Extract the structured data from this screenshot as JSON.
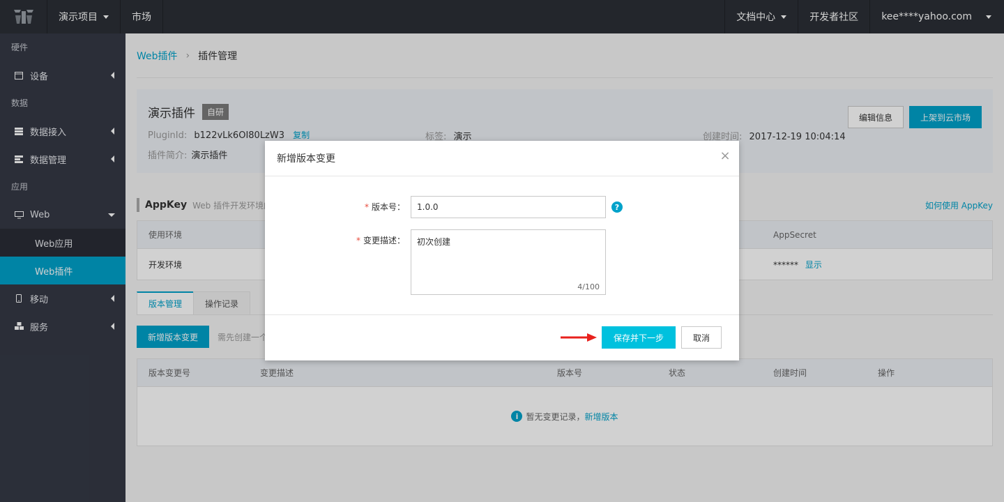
{
  "topbar": {
    "project": "演示项目",
    "market": "市场",
    "docs": "文档中心",
    "community": "开发者社区",
    "account": "kee****yahoo.com"
  },
  "sidebar": {
    "group_hardware": "硬件",
    "device": "设备",
    "group_data": "数据",
    "data_ingest": "数据接入",
    "data_manage": "数据管理",
    "group_app": "应用",
    "web": "Web",
    "web_app": "Web应用",
    "web_plugin": "Web插件",
    "mobile": "移动",
    "service": "服务"
  },
  "breadcrumb": {
    "parent": "Web插件",
    "current": "插件管理"
  },
  "plugin": {
    "name": "演示插件",
    "tag": "自研",
    "id_label": "PluginId:",
    "id_value": "b122vLk6OI80LzW3",
    "copy": "复制",
    "tag_label": "标签:",
    "tag_value": "演示",
    "created_label": "创建时间:",
    "created_value": "2017-12-19 10:04:14",
    "intro_label": "插件简介:",
    "intro_value": "演示插件",
    "edit_btn": "编辑信息",
    "publish_btn": "上架到云市场"
  },
  "appkey": {
    "title": "AppKey",
    "desc": "Web 插件开发环境的",
    "help": "如何使用 AppKey",
    "col_env": "使用环境",
    "col_secret": "AppSecret",
    "row_env": "开发环境",
    "row_secret": "******",
    "row_show": "显示"
  },
  "tabs": {
    "versions": "版本管理",
    "logs": "操作记录"
  },
  "versions": {
    "add_btn": "新增版本变更",
    "hint": "需先创建一个",
    "col_change_no": "版本变更号",
    "col_desc": "变更描述",
    "col_version": "版本号",
    "col_status": "状态",
    "col_created": "创建时间",
    "col_ops": "操作",
    "empty_text": "暂无变更记录，",
    "empty_link": "新增版本"
  },
  "modal": {
    "title": "新增版本变更",
    "version_label": "版本号：",
    "version_value": "1.0.0",
    "desc_label": "变更描述：",
    "desc_value": "初次创建",
    "counter": "4/100",
    "save_btn": "保存并下一步",
    "cancel_btn": "取消"
  },
  "colors": {
    "accent": "#00a2ca",
    "save": "#00c1de",
    "required": "#e84c3d",
    "arrow": "#e8211d"
  }
}
